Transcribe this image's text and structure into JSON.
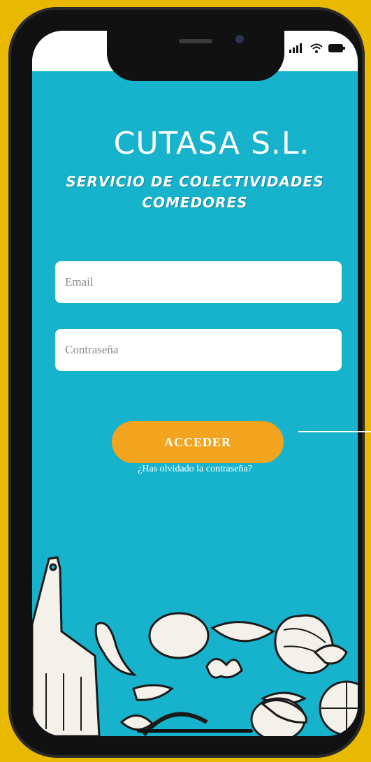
{
  "app": {
    "title": "CUTASA S.L.",
    "subtitle_line1": "SERVICIO DE COLECTIVIDADES",
    "subtitle_line2": "COMEDORES"
  },
  "form": {
    "email_placeholder": "Email",
    "password_placeholder": "Contraseña",
    "submit_label": "ACCEDER",
    "forgot_label": "¿Has olvidado la contraseña?"
  },
  "status": {
    "icons": [
      "signal-icon",
      "wifi-icon",
      "battery-icon"
    ]
  },
  "colors": {
    "background": "#e9b800",
    "screen": "#17b3cd",
    "button": "#f2a41f"
  }
}
